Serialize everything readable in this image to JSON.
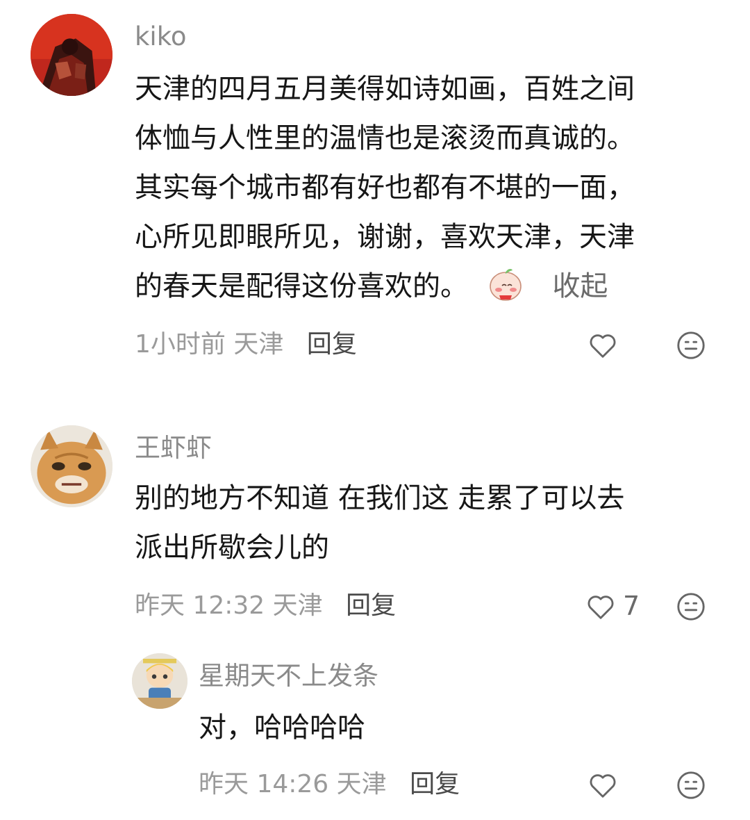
{
  "comments": [
    {
      "username": "kiko",
      "content_lines": [
        "天津的四月五月美得如诗如画，百姓之间",
        "体恤与人性里的温情也是滚烫而真诚的。",
        "其实每个城市都有好也都有不堪的一面，",
        "心所见即眼所见，谢谢，喜欢天津，天津",
        "的春天是配得这份喜欢的。"
      ],
      "inline_emoji": "blushing-peach-emoji",
      "collapse_label": "收起",
      "time": "1小时前",
      "location": "天津",
      "reply_label": "回复",
      "like_icon": "heart-outline-icon",
      "like_count": "",
      "react_icon": "neutral-face-icon"
    },
    {
      "username": "王虾虾",
      "content_lines": [
        "别的地方不知道 在我们这 走累了可以去",
        "派出所歇会儿的"
      ],
      "time": "昨天 12:32",
      "location": "天津",
      "reply_label": "回复",
      "like_icon": "heart-outline-icon",
      "like_count": "7",
      "react_icon": "neutral-face-icon",
      "replies": [
        {
          "username": "星期天不上发条",
          "content_lines": [
            "对，哈哈哈哈"
          ],
          "time": "昨天 14:26",
          "location": "天津",
          "reply_label": "回复",
          "like_icon": "heart-outline-icon",
          "like_count": "",
          "react_icon": "neutral-face-icon"
        }
      ]
    }
  ],
  "colors": {
    "username": "#8a8a8a",
    "meta": "#9a9a9a",
    "text": "#161616",
    "icon": "#666666"
  }
}
